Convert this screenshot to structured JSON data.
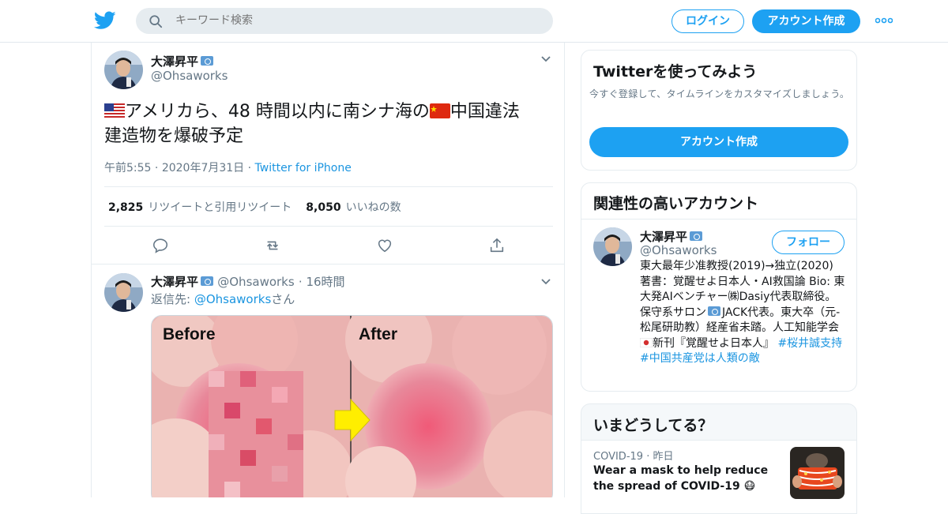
{
  "header": {
    "search_placeholder": "キーワード検索",
    "login_label": "ログイン",
    "signup_label": "アカウント作成",
    "brand_color": "#1da1f2"
  },
  "tweet": {
    "name": "大澤昇平",
    "handle": "@Ohsaworks",
    "text_line1": "アメリカら、48 時間以内に南シナ海の",
    "text_line1b": "中国違法",
    "text_line2": "建造物を爆破予定",
    "time": "午前5:55",
    "date": "2020年7月31日",
    "client": "Twitter for iPhone",
    "retweets_count": "2,825",
    "retweets_label": "リツイートと引用リツイート",
    "likes_count": "8,050",
    "likes_label": "いいねの数",
    "actions": [
      "reply-icon",
      "retweet-icon",
      "like-icon",
      "share-icon"
    ]
  },
  "reply": {
    "name": "大澤昇平",
    "handle": "@Ohsaworks",
    "time": "16時間",
    "reply_prefix": "返信先: ",
    "reply_target": "@Ohsaworks",
    "reply_suffix": "さん",
    "media_before": "Before",
    "media_after": "After"
  },
  "signup_card": {
    "title": "Twitterを使ってみよう",
    "subtitle": "今すぐ登録して、タイムラインをカスタマイズしましょう。",
    "button": "アカウント作成"
  },
  "related_card": {
    "title": "関連性の高いアカウント",
    "name": "大澤昇平",
    "handle": "@Ohsaworks",
    "follow_label": "フォロー",
    "bio_text": "東大最年少准教授(2019)→独立(2020) 著書：覚醒せよ日本人・AI救国論 Bio: 東大発AIベンチャー㈱Dasiy代表取締役。保守系サロン",
    "bio_text2": "JACK代表。東大卒（元-松尾研助教）経産省未踏。人工知能学会 ",
    "bio_text3": "新刊『覚醒せよ日本人』 ",
    "hashtag1": "#桜井誠支持",
    "hashtag2": "#中国共産党は人類の敵"
  },
  "trends_card": {
    "title": "いまどうしてる？",
    "meta_topic": "COVID-19",
    "meta_time": "昨日",
    "headline": "Wear a mask to help reduce the spread of COVID-19 😷"
  }
}
